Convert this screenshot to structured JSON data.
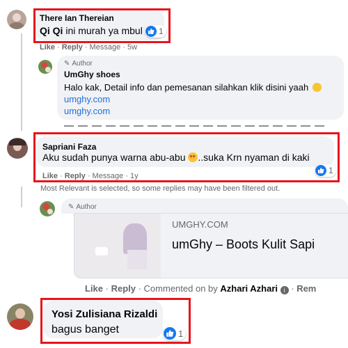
{
  "comment1": {
    "author": "There Ian Thereian",
    "tag": "Qi Qi",
    "text": " ini murah ya mbul",
    "reactions": "1",
    "actions": {
      "like": "Like",
      "reply": "Reply",
      "message": "Message",
      "time": "5w"
    }
  },
  "reply1": {
    "badge": "Author",
    "author": "UmGhy shoes",
    "text": "Halo kak, Detail info dan pemesanan silahkan klik disini yaah",
    "link1": "umghy.com",
    "link2": "umghy.com"
  },
  "comment2": {
    "author": "Sapriani Faza",
    "text_before": "Aku sudah punya warna abu-abu ",
    "text_after": "..suka Krn nyaman di kaki",
    "reactions": "1",
    "actions": {
      "like": "Like",
      "reply": "Reply",
      "message": "Message",
      "time": "1y"
    }
  },
  "notice": "Most Relevant is selected, so some replies may have been filtered out.",
  "reply2": {
    "badge": "Author",
    "link_domain": "UMGHY.COM",
    "link_title": "umGhy – Boots Kulit Sapi",
    "actions": {
      "like": "Like",
      "reply": "Reply",
      "commented": "Commented on by",
      "by": "Azhari Azhari",
      "remove": "Rem"
    }
  },
  "comment3": {
    "author": "Yosi Zulisiana Rizaldi",
    "text": "bagus banget",
    "reactions": "1"
  },
  "colors": {
    "highlight": "#e8141b",
    "link": "#216fdb",
    "like": "#1877f2",
    "bubble": "#f0f2f5"
  }
}
